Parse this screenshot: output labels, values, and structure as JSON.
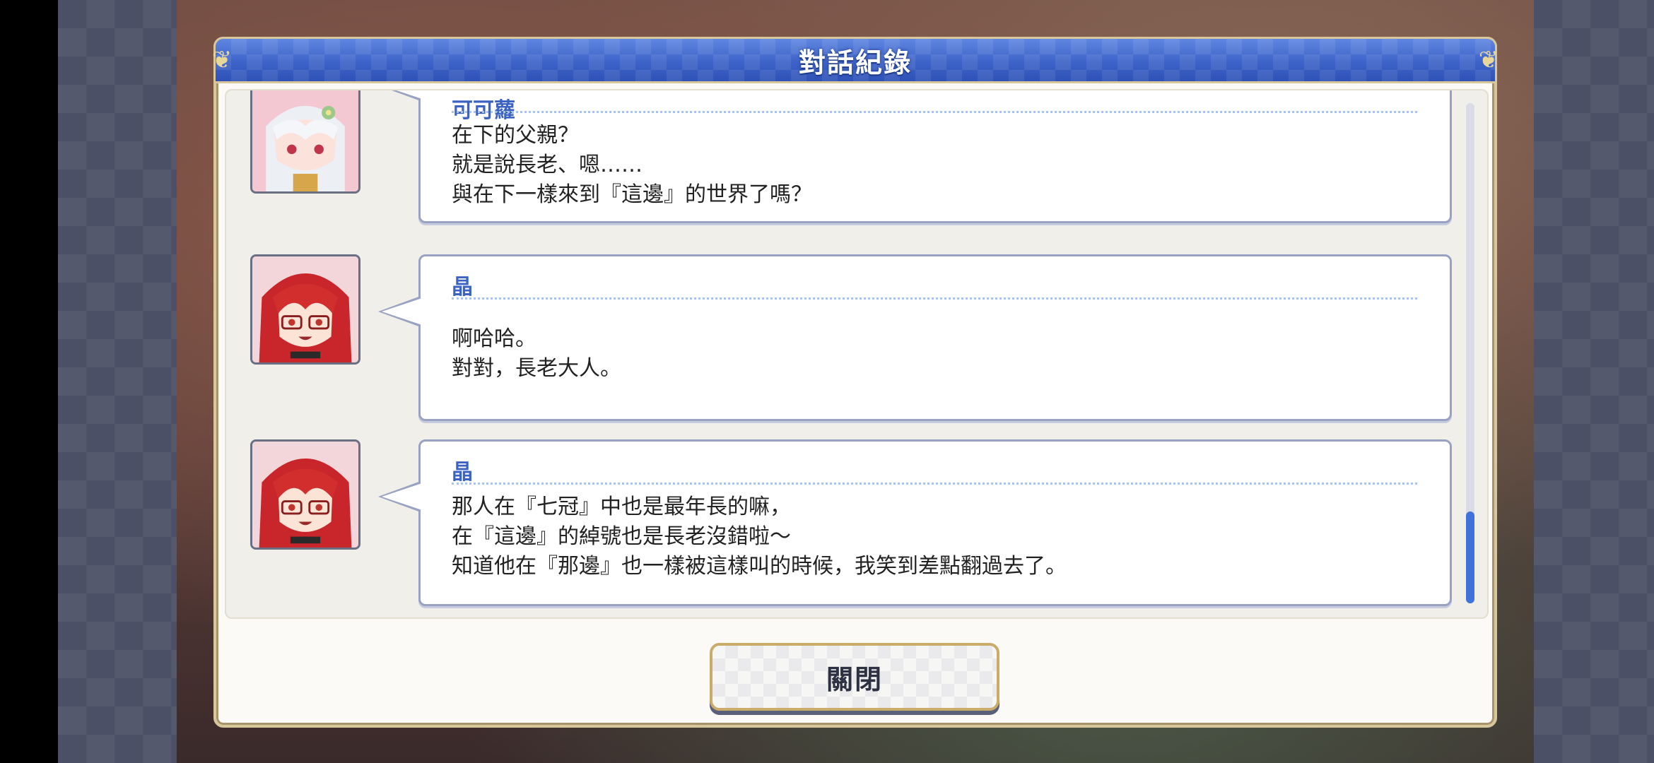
{
  "dialog": {
    "title": "對話紀錄",
    "close_label": "關閉"
  },
  "log": [
    {
      "speaker": "可可蘿",
      "avatar_icon": "kokkoro-portrait-icon",
      "lines": [
        "在下的父親？",
        "就是說長老、嗯……",
        "與在下一樣來到『這邊』的世界了嗎？"
      ]
    },
    {
      "speaker": "晶",
      "avatar_icon": "akira-portrait-icon",
      "lines": [
        "啊哈哈。",
        "對對，長老大人。"
      ]
    },
    {
      "speaker": "晶",
      "avatar_icon": "akira-portrait-icon",
      "lines": [
        "那人在『七冠』中也是最年長的嘛，",
        "在『這邊』的綽號也是長老沒錯啦～",
        "知道他在『那邊』也一樣被這樣叫的時候，我笑到差點翻過去了。"
      ]
    }
  ],
  "colors": {
    "header_blue": "#3d63c8",
    "speaker_blue": "#3b63c4",
    "scroll_thumb": "#3d73db",
    "gold_border": "#d8c79a"
  }
}
